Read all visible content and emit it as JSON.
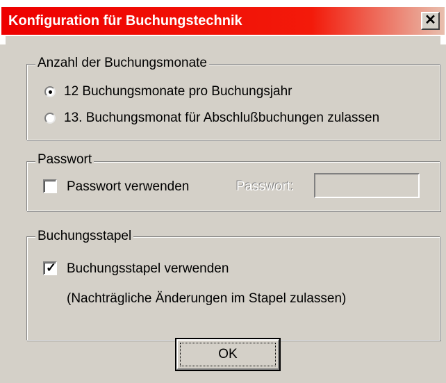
{
  "window": {
    "title": "Konfiguration für Buchungstechnik",
    "close_glyph": "✕",
    "title_gradient": [
      "#ee0000",
      "#e8bfae"
    ]
  },
  "groups": {
    "months": {
      "label": "Anzahl der Buchungsmonate",
      "options": [
        {
          "label": "12 Buchungsmonate pro Buchungsjahr",
          "selected": true
        },
        {
          "label": "13. Buchungsmonat für Abschlußbuchungen zulassen",
          "selected": false
        }
      ]
    },
    "password": {
      "label": "Passwort",
      "checkbox_label": "Passwort verwenden",
      "checked": false,
      "field_label": "Passwort:",
      "field_value": ""
    },
    "batch": {
      "label": "Buchungsstapel",
      "checkbox_label": "Buchungsstapel verwenden",
      "checked": true,
      "note": "(Nachträgliche Änderungen im Stapel zulassen)"
    }
  },
  "buttons": {
    "ok_label": "OK"
  },
  "icons": {
    "close": "close-icon",
    "check": "checkmark-icon"
  }
}
